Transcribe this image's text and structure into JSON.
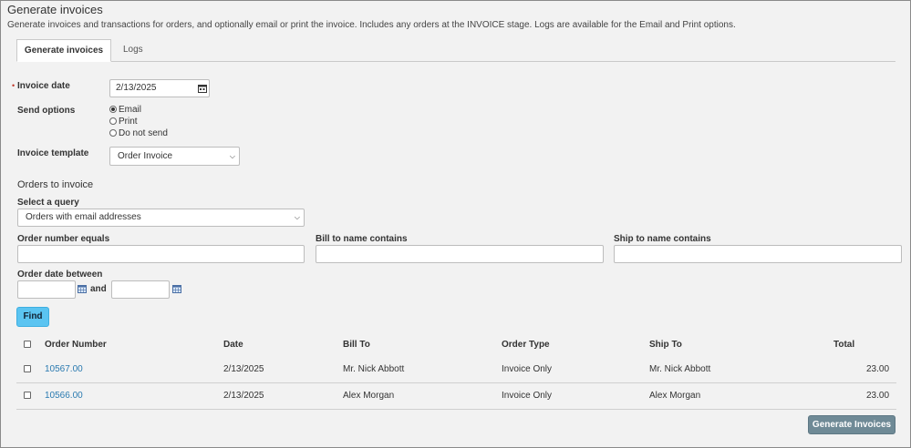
{
  "page": {
    "title": "Generate invoices",
    "description": "Generate invoices and transactions for orders, and optionally email or print the invoice. Includes any orders at the INVOICE stage. Logs are available for the Email and Print options."
  },
  "tabs": [
    {
      "label": "Generate invoices",
      "active": true
    },
    {
      "label": "Logs",
      "active": false
    }
  ],
  "form": {
    "invoice_date_label": "Invoice date",
    "invoice_date_value": "2/13/2025",
    "send_options_label": "Send options",
    "send_options": [
      {
        "label": "Email",
        "selected": true
      },
      {
        "label": "Print",
        "selected": false
      },
      {
        "label": "Do not send",
        "selected": false
      }
    ],
    "invoice_template_label": "Invoice template",
    "invoice_template_value": "Order Invoice"
  },
  "orders": {
    "section_title": "Orders to invoice",
    "query_label": "Select a query",
    "query_value": "Orders with email addresses",
    "order_number_label": "Order number equals",
    "bill_to_label": "Bill to name contains",
    "ship_to_label": "Ship to name contains",
    "order_date_label": "Order date between",
    "and_label": "and",
    "find_label": "Find"
  },
  "table": {
    "headers": {
      "order_number": "Order Number",
      "date": "Date",
      "bill_to": "Bill To",
      "order_type": "Order Type",
      "ship_to": "Ship To",
      "total": "Total"
    },
    "rows": [
      {
        "order_number": "10567.00",
        "date": "2/13/2025",
        "bill_to": "Mr. Nick Abbott",
        "order_type": "Invoice Only",
        "ship_to": "Mr. Nick Abbott",
        "total": "23.00"
      },
      {
        "order_number": "10566.00",
        "date": "2/13/2025",
        "bill_to": "Alex Morgan",
        "order_type": "Invoice Only",
        "ship_to": "Alex Morgan",
        "total": "23.00"
      }
    ]
  },
  "actions": {
    "generate_label": "Generate Invoices"
  },
  "colors": {
    "find_button": "#5bc4f1",
    "generate_button": "#6f8a96",
    "link": "#2a7ab0",
    "required_marker": "#c0392b"
  }
}
